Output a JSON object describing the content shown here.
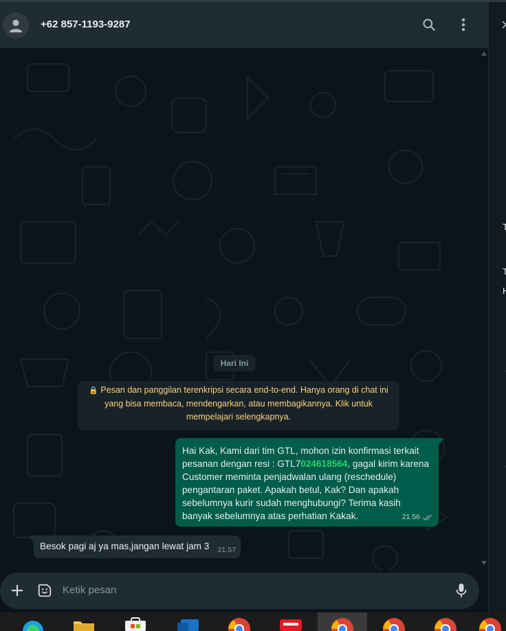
{
  "header": {
    "contact_name": "+62 857-1193-9287",
    "icons": [
      "avatar-icon",
      "search-icon",
      "menu-icon"
    ]
  },
  "chat": {
    "date_label": "Hari Ini",
    "encryption_notice": "Pesan dan panggilan terenkripsi secara end-to-end. Hanya orang di chat ini yang bisa membaca, mendengarkan, atau membagikannya. Klik untuk mempelajari selengkapnya.",
    "messages": [
      {
        "direction": "out",
        "text_before": "Hai Kak, Kami dari tim GTL, mohon izin konfirmasi terkait pesanan dengan resi : GTL7",
        "highlight": "024618564",
        "text_after": ", gagal kirim karena Customer meminta penjadwalan ulang (reschedule) pengantaran paket. Apakah betul, Kak? Dan apakah sebelumnya kurir sudah menghubungi? Terima kasih banyak sebelumnya atas perhatian Kakak.",
        "time": "21.56",
        "status": "read"
      },
      {
        "direction": "in",
        "text": "Besok pagi aj ya mas,jangan lewat jam 3",
        "time": "21.57"
      }
    ]
  },
  "compose": {
    "placeholder": "Ketik pesan",
    "icons": [
      "plus-icon",
      "sticker-icon",
      "microphone-icon"
    ]
  },
  "right_panel": {
    "partial_texts": [
      "T",
      "T",
      "H"
    ]
  },
  "taskbar": {
    "apps": [
      "edge",
      "file-explorer",
      "microsoft-store",
      "outlook",
      "chrome",
      "app-red",
      "chrome",
      "chrome",
      "chrome",
      "chrome"
    ]
  },
  "colors": {
    "header_bg": "#202c33",
    "chat_bg": "#0b141a",
    "outgoing_bubble": "#005c4b",
    "incoming_bubble": "#202c33",
    "notice_text": "#ffd279",
    "highlight_green": "#25d366"
  }
}
